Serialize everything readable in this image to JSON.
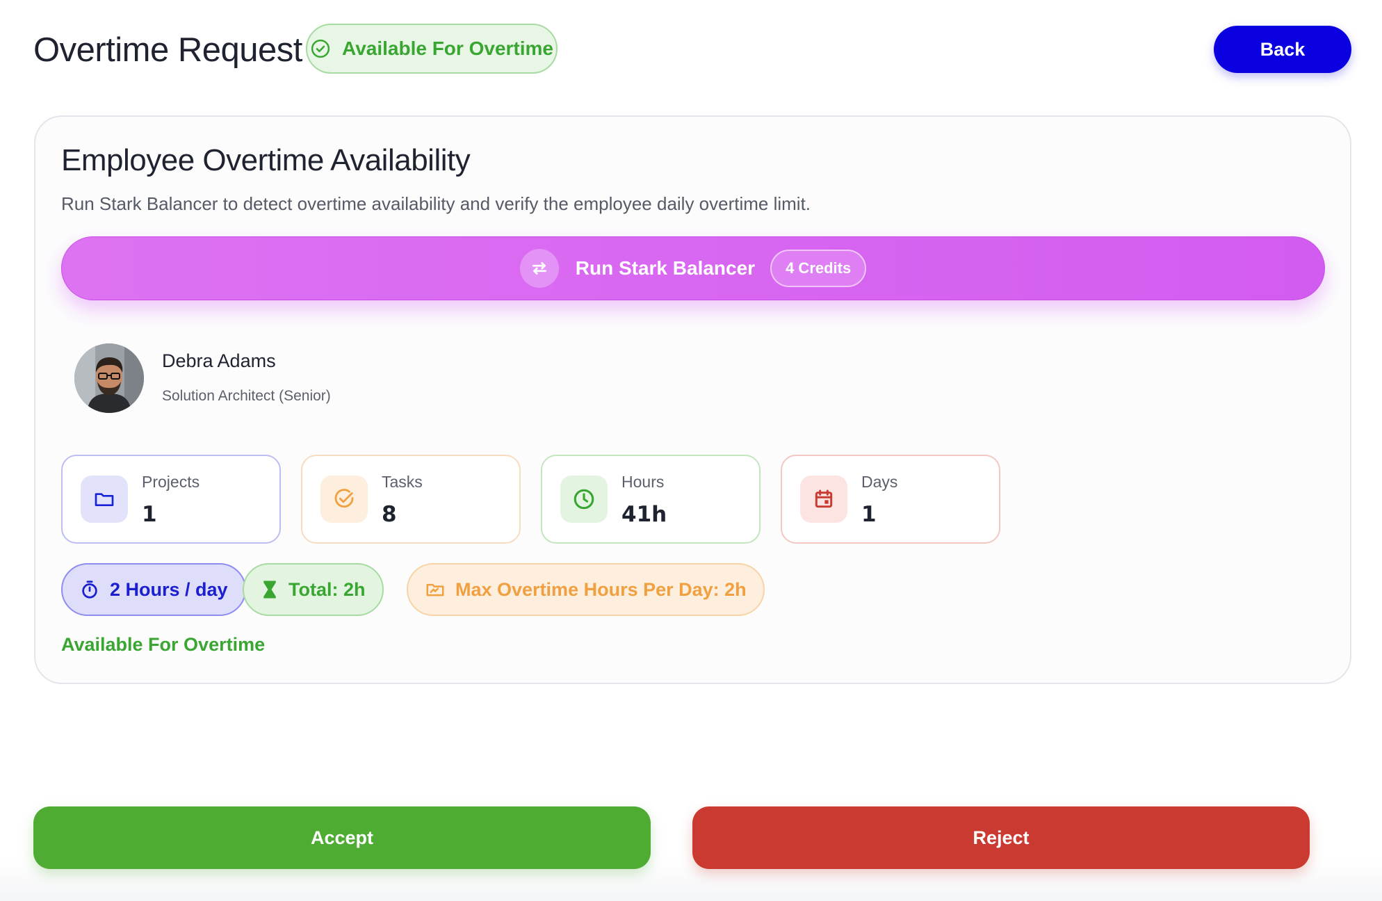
{
  "header": {
    "title": "Overtime Request",
    "status_badge": "Available For Overtime",
    "back_label": "Back"
  },
  "card": {
    "title": "Employee Overtime Availability",
    "subtitle": "Run Stark Balancer to detect overtime availability and verify the employee daily overtime limit.",
    "run_button": {
      "label": "Run Stark Balancer",
      "credits": "4 Credits"
    }
  },
  "employee": {
    "name": "Debra Adams",
    "role": "Solution Architect (Senior)"
  },
  "stats": [
    {
      "label": "Projects",
      "value": "1",
      "icon": "folder-icon",
      "color": "#1a22d8"
    },
    {
      "label": "Tasks",
      "value": "8",
      "icon": "check-circle-icon",
      "color": "#f0a040"
    },
    {
      "label": "Hours",
      "value": "41h",
      "icon": "clock-icon",
      "color": "#3aa632"
    },
    {
      "label": "Days",
      "value": "1",
      "icon": "calendar-icon",
      "color": "#cb3a30"
    }
  ],
  "pills": {
    "per_day": "2 Hours / day",
    "total": "Total: 2h",
    "max": "Max Overtime Hours Per Day: 2h"
  },
  "availability_text": "Available For Overtime",
  "actions": {
    "accept": "Accept",
    "reject": "Reject"
  },
  "colors": {
    "primary": "#0a00e0",
    "success": "#4eac32",
    "danger": "#cb3a30",
    "accent": "#d65ff0",
    "warning": "#f0a040"
  }
}
